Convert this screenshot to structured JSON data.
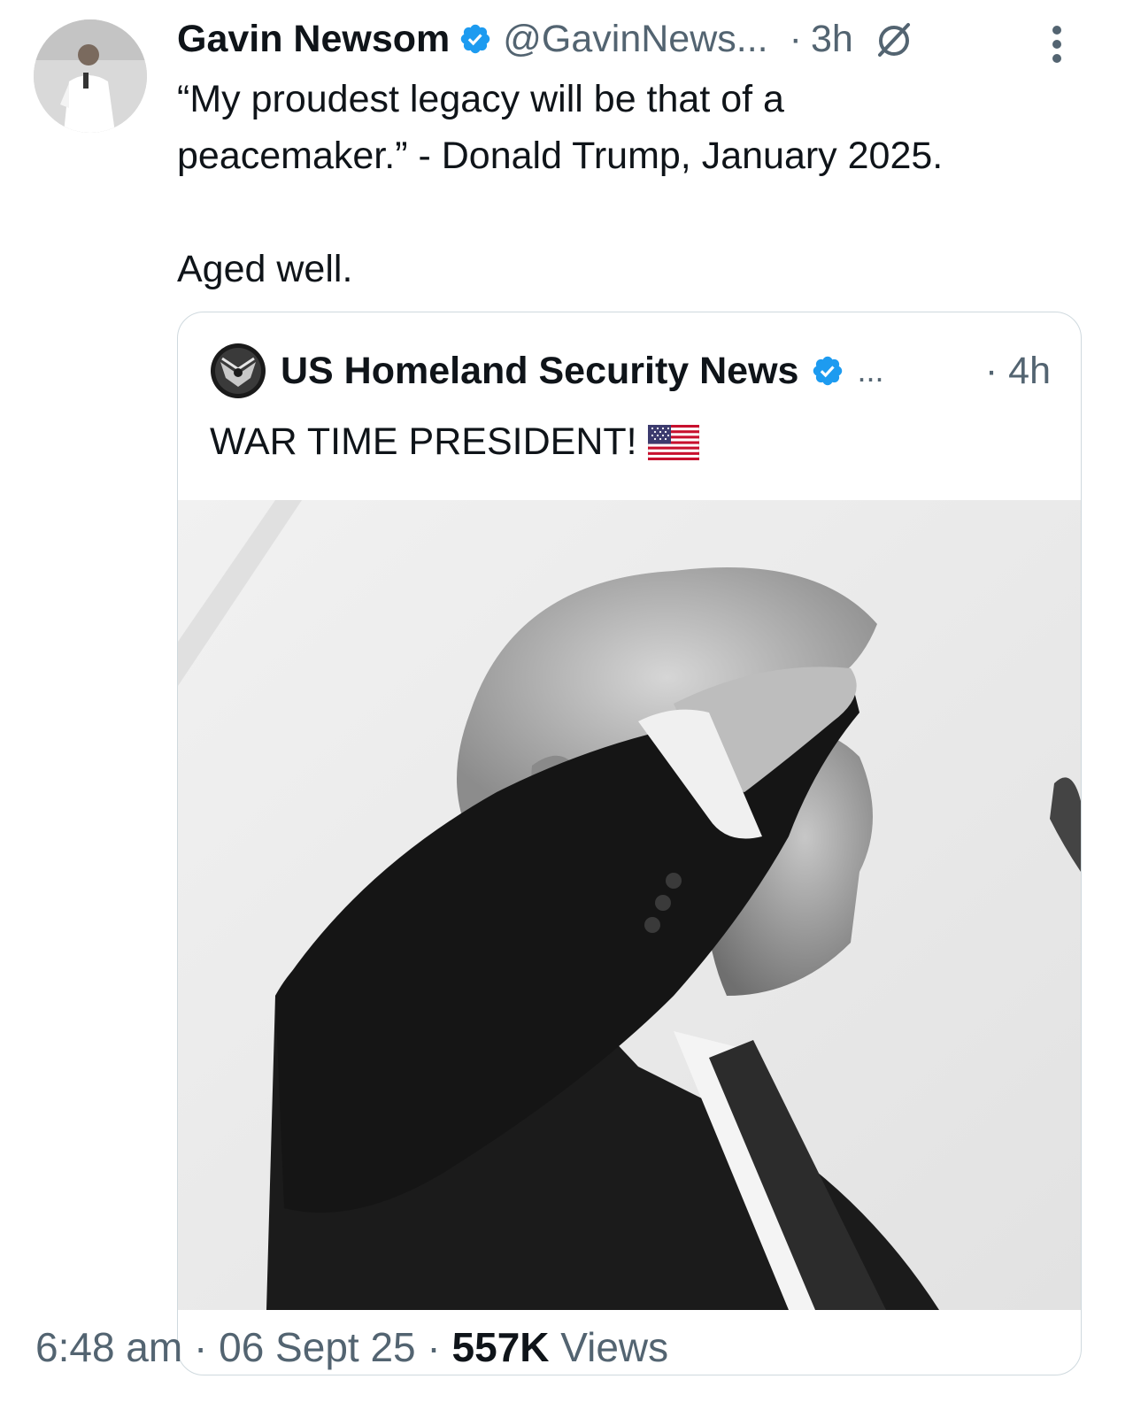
{
  "tweet": {
    "author_name": "Gavin Newsom",
    "handle": "@GavinNews...",
    "separator": "·",
    "time": "3h",
    "text": "“My proudest legacy will be that of a\npeacemaker.” - Donald Trump, January 2025.\n\nAged well.",
    "icons": {
      "avatar": "avatar-photo",
      "verified": "verified-badge-icon",
      "grok": "grok-icon",
      "more": "more-options-icon"
    }
  },
  "quote": {
    "author_name": "US Homeland Security News",
    "ellipsis": "...",
    "time": "· 4h",
    "text": "WAR TIME PRESIDENT!",
    "icons": {
      "avatar": "shield-eagle-logo",
      "verified": "verified-badge-icon",
      "flag": "us-flag-emoji"
    }
  },
  "meta": {
    "time": "6:48 am",
    "date": "06 Sept 25",
    "separator": "·",
    "views_count": "557K",
    "views_label": "Views"
  },
  "colors": {
    "text": "#0f1419",
    "secondary": "#536471",
    "verified": "#1d9bf0",
    "border": "#cfd9de"
  }
}
